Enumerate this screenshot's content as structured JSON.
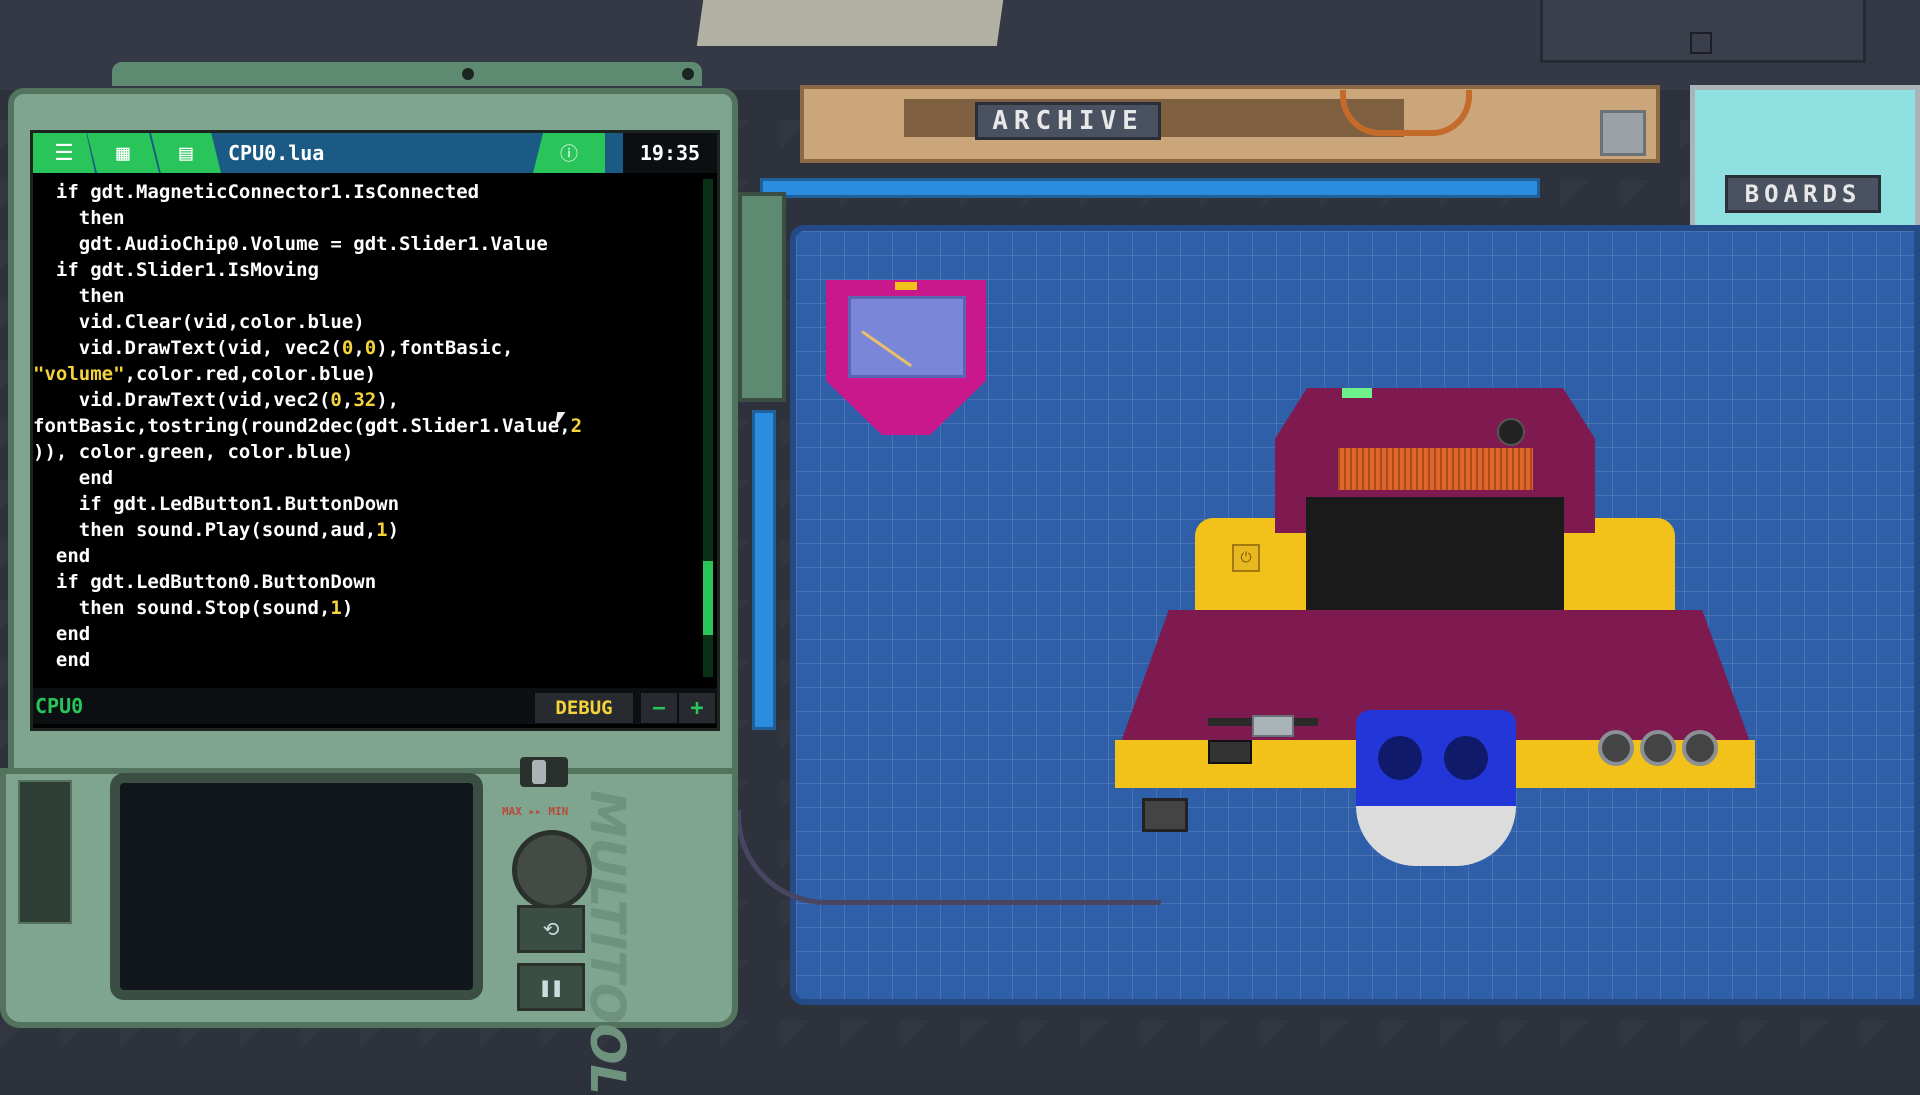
{
  "shelves": {
    "archive_label": "ARCHIVE",
    "boards_label": "BOARDS"
  },
  "terminal": {
    "filename": "CPU0.lua",
    "clock": "19:35",
    "menu_icon": "hamburger-menu-icon",
    "board_icon": "circuit-board-icon",
    "document_icon": "document-icon",
    "info_icon": "info-icon",
    "code_lines": [
      [
        {
          "t": "  if gdt.MagneticConnector1.IsConnected",
          "c": ""
        }
      ],
      [
        {
          "t": "    then",
          "c": ""
        }
      ],
      [
        {
          "t": "    gdt.AudioChip0.Volume = gdt.Slider1.Value",
          "c": ""
        }
      ],
      [
        {
          "t": "  if gdt.Slider1.IsMoving",
          "c": ""
        }
      ],
      [
        {
          "t": "    then",
          "c": ""
        }
      ],
      [
        {
          "t": "    vid.Clear(vid,color.blue)",
          "c": "hl"
        }
      ],
      [
        {
          "t": "    vid.DrawText(vid, vec2(",
          "c": ""
        },
        {
          "t": "0",
          "c": "num"
        },
        {
          "t": ",",
          "c": ""
        },
        {
          "t": "0",
          "c": "num"
        },
        {
          "t": "),fontBasic,",
          "c": ""
        }
      ],
      [
        {
          "t": "\"volume\"",
          "c": "str"
        },
        {
          "t": ",color.red,color.blue)",
          "c": ""
        }
      ],
      [
        {
          "t": "    vid.DrawText(vid,vec2(",
          "c": ""
        },
        {
          "t": "0",
          "c": "num"
        },
        {
          "t": ",",
          "c": ""
        },
        {
          "t": "32",
          "c": "num"
        },
        {
          "t": "),",
          "c": ""
        }
      ],
      [
        {
          "t": "fontBasic,tostring(round2dec(gdt.Slider1.Value,",
          "c": ""
        },
        {
          "t": "2",
          "c": "num"
        }
      ],
      [
        {
          "t": ")), color.green, color.blue)",
          "c": ""
        }
      ],
      [
        {
          "t": "    end",
          "c": ""
        }
      ],
      [
        {
          "t": "    if gdt.LedButton1.ButtonDown",
          "c": ""
        }
      ],
      [
        {
          "t": "    then sound.Play(sound,aud,",
          "c": ""
        },
        {
          "t": "1",
          "c": "num"
        },
        {
          "t": ")",
          "c": ""
        }
      ],
      [
        {
          "t": "  end",
          "c": ""
        }
      ],
      [
        {
          "t": "  if gdt.LedButton0.ButtonDown",
          "c": ""
        }
      ],
      [
        {
          "t": "    then sound.Stop(sound,",
          "c": ""
        },
        {
          "t": "1",
          "c": "num"
        },
        {
          "t": ")",
          "c": ""
        }
      ],
      [
        {
          "t": "  end",
          "c": ""
        }
      ],
      [
        {
          "t": "  end",
          "c": ""
        }
      ]
    ],
    "status": {
      "cpu_label": "CPU0",
      "debug_label": "DEBUG",
      "minus_label": "−",
      "plus_label": "+"
    }
  },
  "multitool": {
    "brand_text": "MULTITOOL",
    "max_label": "MAX",
    "min_label": "MIN",
    "reset_icon": "reset-icon",
    "pause_icon": "pause-icon"
  },
  "device": {
    "power_icon": "power-icon"
  },
  "colors": {
    "terminal_header": "#1b5a84",
    "tab_green": "#29c45a",
    "code_number": "#f5d33a",
    "mat_blue": "#2f5fa8",
    "device_purple": "#7e1a4f",
    "device_yellow": "#f2c21a"
  }
}
